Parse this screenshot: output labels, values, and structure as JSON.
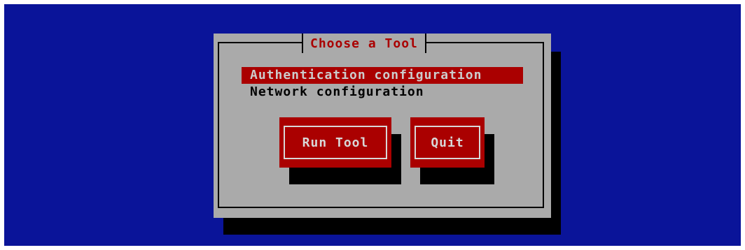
{
  "dialog": {
    "title": "Choose a Tool"
  },
  "tools": [
    {
      "label": "Authentication configuration",
      "selected": true
    },
    {
      "label": "Network configuration",
      "selected": false
    }
  ],
  "buttons": {
    "run_tool_label": "Run Tool",
    "quit_label": "Quit"
  },
  "colors": {
    "screen_background": "#0a1499",
    "dialog_background": "#aaaaaa",
    "accent_red": "#aa0000",
    "shadow": "#000000"
  }
}
